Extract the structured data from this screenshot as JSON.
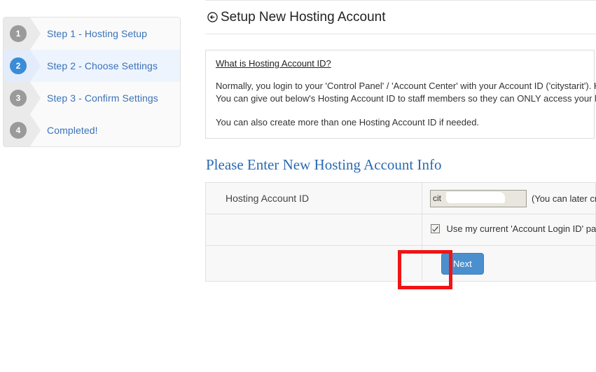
{
  "wizard": {
    "steps": [
      {
        "number": "1",
        "label": "Step 1 - Hosting Setup",
        "active": false
      },
      {
        "number": "2",
        "label": "Step 2 - Choose Settings",
        "active": true
      },
      {
        "number": "3",
        "label": "Step 3 - Confirm Settings",
        "active": false
      },
      {
        "number": "4",
        "label": "Completed!",
        "active": false
      }
    ]
  },
  "header": {
    "title": "Setup New Hosting Account",
    "icon": "arrow-left-circle-icon"
  },
  "info_box": {
    "heading": "What is Hosting Account ID?",
    "paragraph1_line1": "Normally, you login to your 'Control Panel' / 'Account Center' with your Account ID ('citystarit'). How",
    "paragraph1_line2": "You can give out below's Hosting Account ID to staff members so they can ONLY access your hostin",
    "paragraph2": "You can also create more than one Hosting Account ID if needed."
  },
  "form": {
    "section_title": "Please Enter New Hosting Account Info",
    "rows": [
      {
        "label": "Hosting Account ID",
        "input_value": "cit",
        "input_placeholder": "",
        "hint": "(You can later create ad"
      }
    ],
    "checkbox": {
      "checked": true,
      "label": "Use my current 'Account Login ID' password."
    },
    "next_button": "Next"
  },
  "annotation": {
    "shape": "rectangle",
    "color": "#f01414",
    "target": "next-button"
  },
  "colors": {
    "accent_blue": "#3a72b8",
    "active_step": "#3b8cd6",
    "section_heading": "#2a6ab0",
    "button": "#4a90ce",
    "annotation_red": "#f01414",
    "input_bg": "#e9e6de"
  }
}
